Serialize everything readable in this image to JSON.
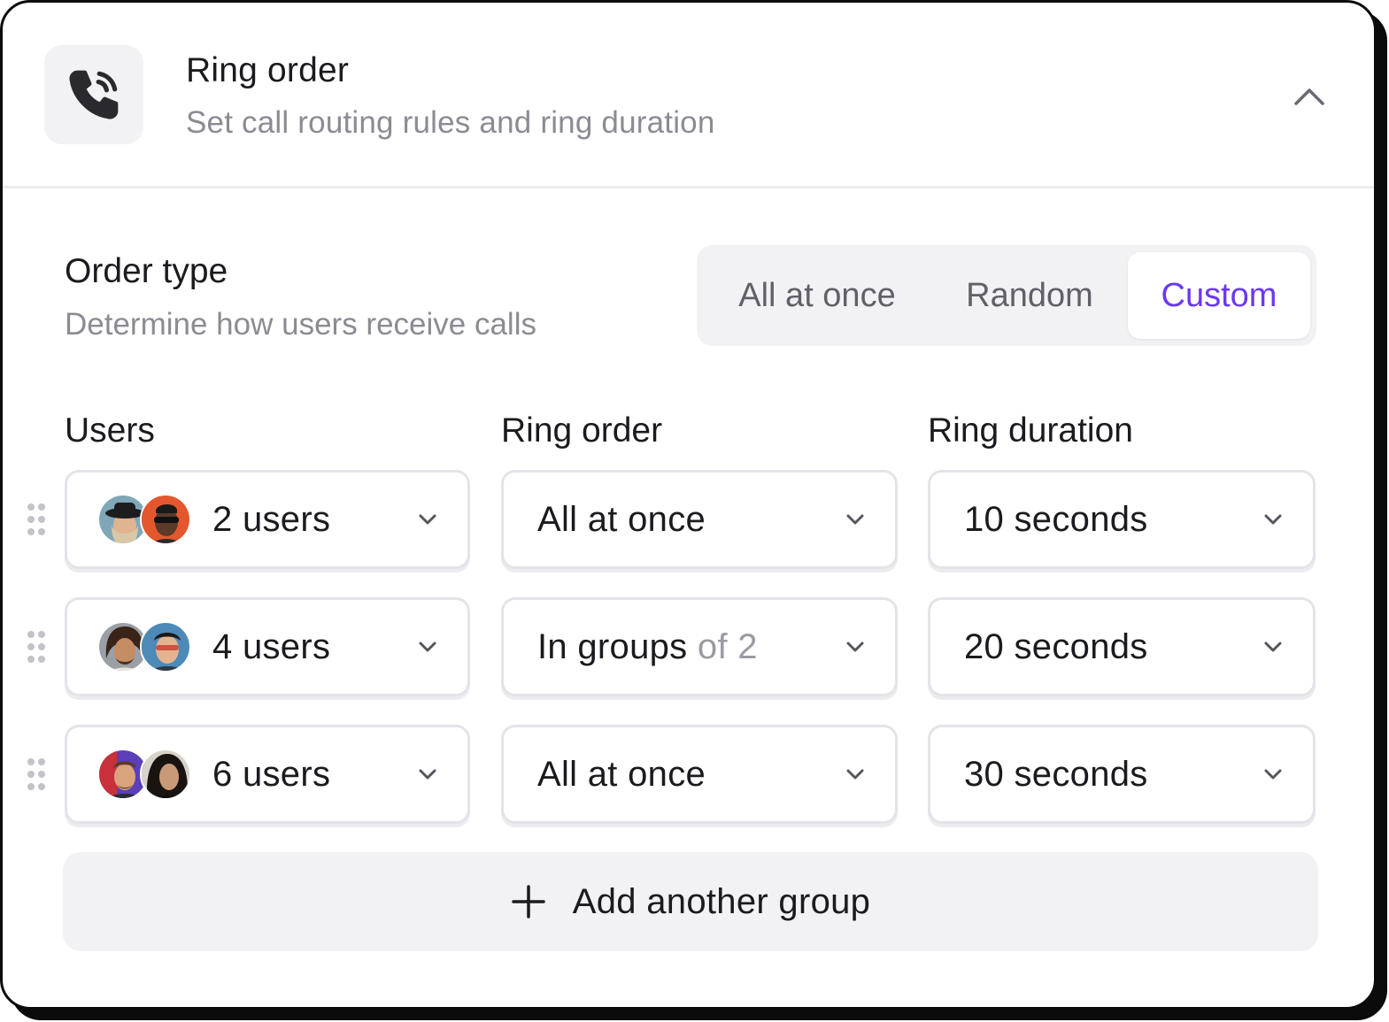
{
  "header": {
    "title": "Ring order",
    "subtitle": "Set call routing rules and ring duration",
    "icon": "phone-ringing-icon",
    "collapse_icon": "chevron-up-icon"
  },
  "order_type": {
    "title": "Order type",
    "subtitle": "Determine how users receive calls",
    "options": [
      "All at once",
      "Random",
      "Custom"
    ],
    "selected": "Custom",
    "selected_color": "#6a38ef"
  },
  "columns": {
    "users": "Users",
    "ring_order": "Ring order",
    "ring_duration": "Ring duration"
  },
  "rows": [
    {
      "users": "2 users",
      "ring_order": "All at once",
      "ring_order_suffix": "",
      "ring_duration": "10 seconds"
    },
    {
      "users": "4 users",
      "ring_order": "In groups",
      "ring_order_suffix": "of 2",
      "ring_duration": "20 seconds"
    },
    {
      "users": "6 users",
      "ring_order": "All at once",
      "ring_order_suffix": "",
      "ring_duration": "30 seconds"
    }
  ],
  "add_button": {
    "label": "Add another group",
    "icon": "plus-icon"
  }
}
